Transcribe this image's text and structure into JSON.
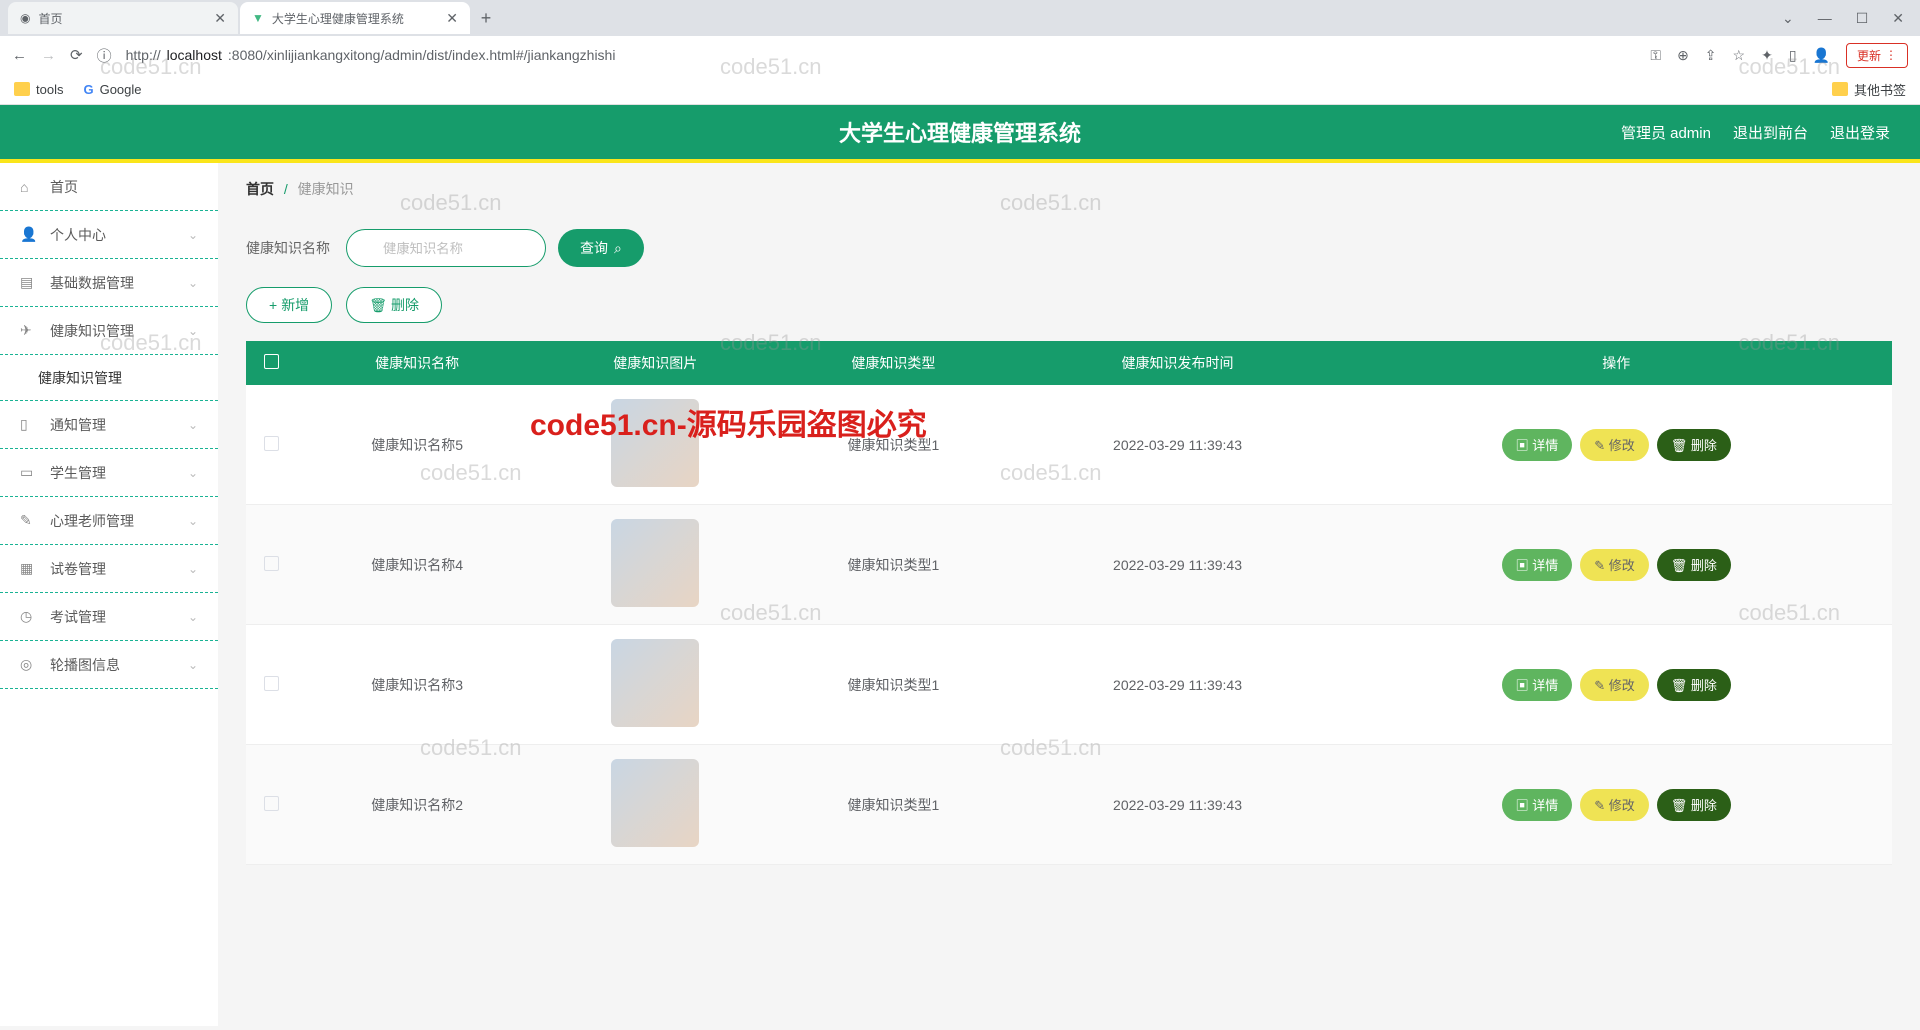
{
  "browser": {
    "tabs": [
      {
        "title": "首页",
        "active": false
      },
      {
        "title": "大学生心理健康管理系统",
        "active": true
      }
    ],
    "url_host": "localhost",
    "url_port_path": ":8080/xinlijiankangxitong/admin/dist/index.html#/jiankangzhishi",
    "url_scheme": "http://",
    "update_label": "更新",
    "bookmarks": {
      "tools": "tools",
      "google": "Google",
      "other": "其他书签"
    },
    "win": {
      "min": "—",
      "max": "☐",
      "close": "✕",
      "expand": "⌄"
    }
  },
  "header": {
    "title": "大学生心理健康管理系统",
    "admin_label": "管理员 admin",
    "back_front": "退出到前台",
    "logout": "退出登录"
  },
  "sidebar": {
    "items": [
      {
        "icon": "home",
        "label": "首页",
        "expandable": false
      },
      {
        "icon": "user",
        "label": "个人中心",
        "expandable": true
      },
      {
        "icon": "data",
        "label": "基础数据管理",
        "expandable": true
      },
      {
        "icon": "send",
        "label": "健康知识管理",
        "expandable": true,
        "open": true,
        "children": [
          {
            "label": "健康知识管理"
          }
        ]
      },
      {
        "icon": "notify",
        "label": "通知管理",
        "expandable": true
      },
      {
        "icon": "student",
        "label": "学生管理",
        "expandable": true
      },
      {
        "icon": "teacher",
        "label": "心理老师管理",
        "expandable": true
      },
      {
        "icon": "exam",
        "label": "试卷管理",
        "expandable": true
      },
      {
        "icon": "test",
        "label": "考试管理",
        "expandable": true
      },
      {
        "icon": "carousel",
        "label": "轮播图信息",
        "expandable": true
      }
    ]
  },
  "breadcrumb": {
    "home": "首页",
    "current": "健康知识"
  },
  "search": {
    "label": "健康知识名称",
    "placeholder": "健康知识名称",
    "query_btn": "查询"
  },
  "actions": {
    "add": "新增",
    "delete": "删除"
  },
  "table": {
    "columns": [
      "",
      "健康知识名称",
      "健康知识图片",
      "健康知识类型",
      "健康知识发布时间",
      "操作"
    ],
    "row_buttons": {
      "detail": "详情",
      "edit": "修改",
      "delete": "删除"
    },
    "rows": [
      {
        "name": "健康知识名称5",
        "type": "健康知识类型1",
        "time": "2022-03-29 11:39:43"
      },
      {
        "name": "健康知识名称4",
        "type": "健康知识类型1",
        "time": "2022-03-29 11:39:43"
      },
      {
        "name": "健康知识名称3",
        "type": "健康知识类型1",
        "time": "2022-03-29 11:39:43"
      },
      {
        "name": "健康知识名称2",
        "type": "健康知识类型1",
        "time": "2022-03-29 11:39:43"
      }
    ]
  },
  "watermark": {
    "text": "code51.cn",
    "red": "code51.cn-源码乐园盗图必究"
  }
}
